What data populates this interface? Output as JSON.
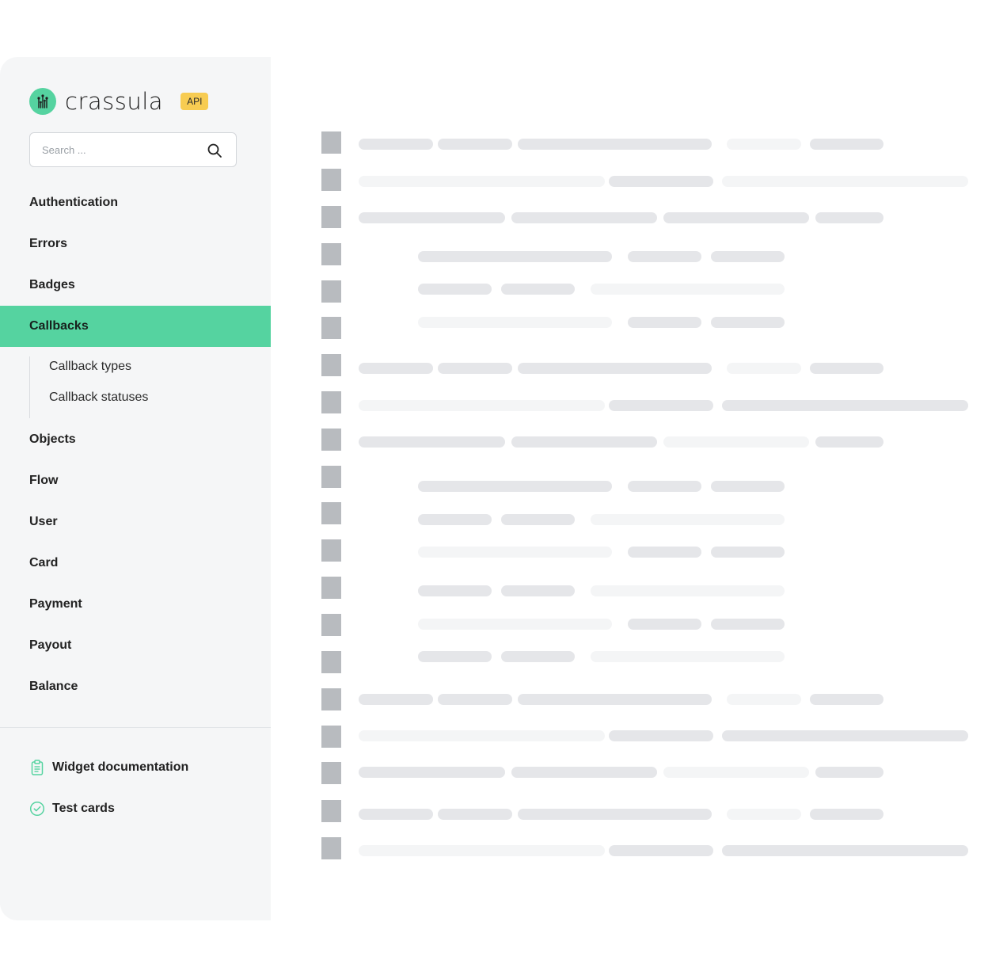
{
  "brand": {
    "name": "crassula",
    "badge": "API",
    "accent_color": "#55d3a0",
    "badge_color": "#f7cc52",
    "logo_icon": "circuit-tree-icon"
  },
  "search": {
    "placeholder": "Search ...",
    "icon": "search-icon"
  },
  "nav": {
    "items": [
      {
        "label": "Authentication",
        "active": false
      },
      {
        "label": "Errors",
        "active": false
      },
      {
        "label": "Badges",
        "active": false
      },
      {
        "label": "Callbacks",
        "active": true
      },
      {
        "label": "Objects",
        "active": false
      },
      {
        "label": "Flow",
        "active": false
      },
      {
        "label": "User",
        "active": false
      },
      {
        "label": "Card",
        "active": false
      },
      {
        "label": "Payment",
        "active": false
      },
      {
        "label": "Payout",
        "active": false
      },
      {
        "label": "Balance",
        "active": false
      }
    ],
    "sub_items": [
      {
        "label": "Callback types"
      },
      {
        "label": "Callback statuses"
      }
    ]
  },
  "footer": {
    "links": [
      {
        "label": "Widget documentation",
        "icon": "clipboard-icon"
      },
      {
        "label": "Test cards",
        "icon": "check-circle-icon"
      }
    ]
  },
  "content": {
    "state": "loading-skeleton",
    "skeleton_color_dark": "#e5e6e9",
    "skeleton_color_light": "#f4f5f6",
    "marker_color": "#b8bbbf"
  }
}
